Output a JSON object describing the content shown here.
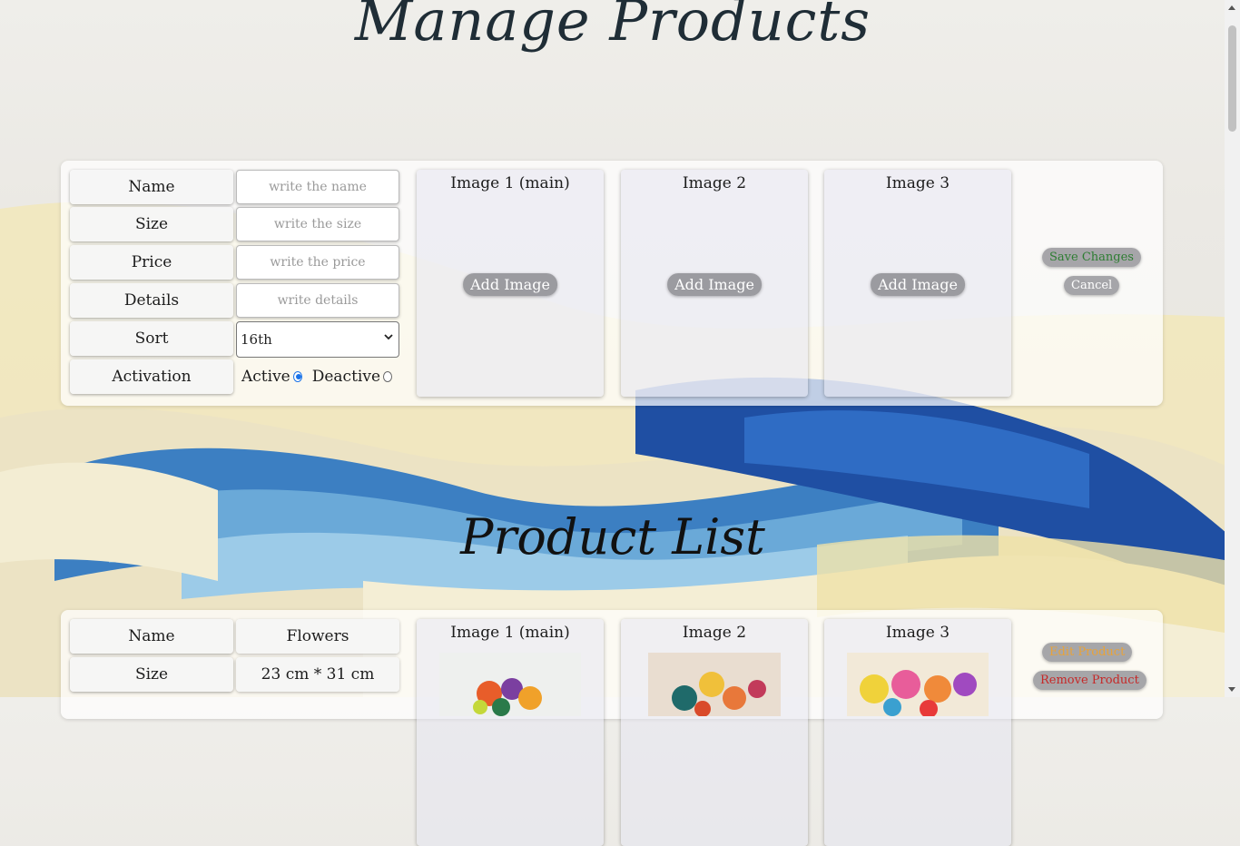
{
  "page": {
    "title": "Manage Products",
    "list_title": "Product List"
  },
  "form": {
    "name_label": "Name",
    "name_placeholder": "write the name",
    "size_label": "Size",
    "size_placeholder": "write the size",
    "price_label": "Price",
    "price_placeholder": "write the price",
    "details_label": "Details",
    "details_placeholder": "write details",
    "sort_label": "Sort",
    "sort_value": "16th",
    "activation_label": "Activation",
    "active_label": "Active",
    "deactive_label": "Deactive",
    "active_selected": true
  },
  "image_cards": [
    {
      "title": "Image 1 (main)",
      "button": "Add Image"
    },
    {
      "title": "Image 2",
      "button": "Add Image"
    },
    {
      "title": "Image 3",
      "button": "Add Image"
    }
  ],
  "form_actions": {
    "save_label": "Save Changes",
    "save_color": "#2e7d32",
    "cancel_label": "Cancel"
  },
  "product": {
    "name_label": "Name",
    "name_value": "Flowers",
    "size_label": "Size",
    "size_value": "23 cm * 31 cm",
    "images": [
      {
        "title": "Image 1 (main)"
      },
      {
        "title": "Image 2"
      },
      {
        "title": "Image 3"
      }
    ],
    "edit_label": "Edit Product",
    "edit_color": "#e8a33a",
    "remove_label": "Remove Product",
    "remove_color": "#c62828"
  }
}
